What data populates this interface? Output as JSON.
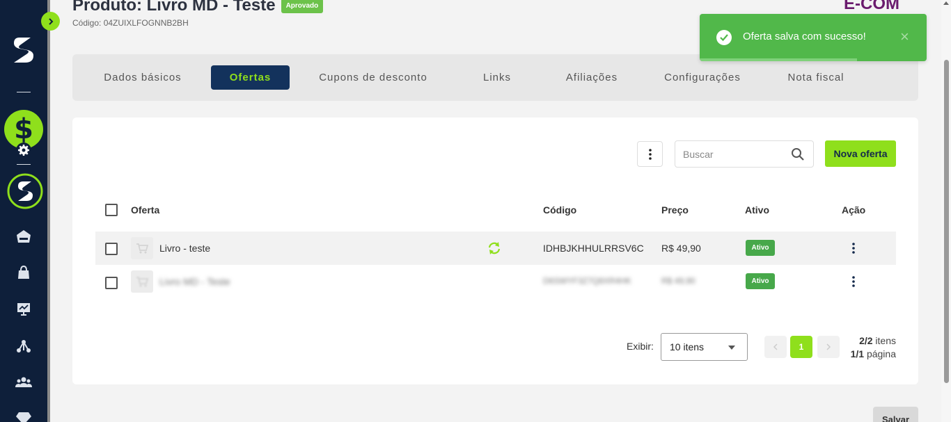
{
  "product": {
    "title": "Produto: Livro MD - Teste",
    "status": "Aprovado",
    "code_label": "Código: 04ZUIXLFOGNNB2BH"
  },
  "brand": {
    "logo_text": "E-COM"
  },
  "tabs": [
    {
      "label": "Dados básicos",
      "active": false
    },
    {
      "label": "Ofertas",
      "active": true
    },
    {
      "label": "Cupons de desconto",
      "active": false
    },
    {
      "label": "Links",
      "active": false
    },
    {
      "label": "Afiliações",
      "active": false
    },
    {
      "label": "Configurações",
      "active": false
    },
    {
      "label": "Nota fiscal",
      "active": false
    }
  ],
  "toast": {
    "message": "Oferta salva com sucesso!",
    "close": "×"
  },
  "toolbar": {
    "search_placeholder": "Buscar",
    "new_offer_label": "Nova oferta"
  },
  "table": {
    "headers": {
      "offer": "Oferta",
      "code": "Código",
      "price": "Preço",
      "active": "Ativo",
      "action": "Ação"
    },
    "rows": [
      {
        "name": "Livro - teste",
        "code": "IDHBJKHHULRRSV6C",
        "price": "R$ 49,90",
        "status": "Ativo"
      },
      {
        "name": "Livro MD - Teste",
        "code": "D6SWYF3Z7Q8XR4HK",
        "price": "R$ 49,90",
        "status": "Ativo"
      }
    ]
  },
  "pagination": {
    "show_label": "Exibir:",
    "per_page": "10 itens",
    "current_page": "1",
    "items_count": "2/2",
    "items_label": "itens",
    "pages_count": "1/1",
    "pages_label": "página"
  },
  "footer": {
    "save_label": "Salvar"
  },
  "colors": {
    "accent": "#8fdf1c",
    "navy": "#0e1f3a",
    "success": "#51b84a"
  }
}
